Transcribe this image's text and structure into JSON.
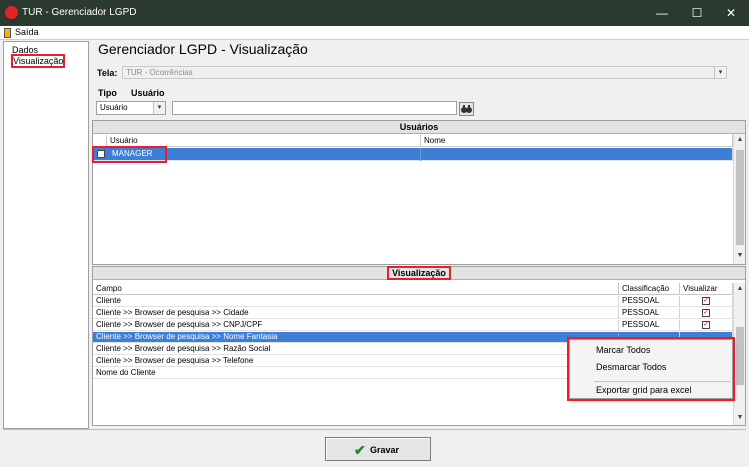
{
  "window": {
    "title": "TUR - Gerenciador LGPD",
    "minimize": "—",
    "maximize": "☐",
    "close": "✕"
  },
  "menubar": {
    "exit_label": "Saída"
  },
  "sidebar": {
    "items": [
      {
        "label": "Dados"
      },
      {
        "label": "Visualização"
      }
    ]
  },
  "main": {
    "heading": "Gerenciador LGPD - Visualização",
    "tela_label": "Tela:",
    "tela_value": "TUR - Ocorrências",
    "tipo_label": "Tipo",
    "usuario_label": "Usuário",
    "tipo_value": "Usuário",
    "usuario_value": ""
  },
  "usuarios_grid": {
    "title": "Usuários",
    "columns": [
      "Usuário",
      "Nome"
    ],
    "rows": [
      {
        "usuario": "MANAGER",
        "nome": ""
      }
    ]
  },
  "visualizacao_grid": {
    "title": "Visualização",
    "columns": [
      "Campo",
      "Classificação",
      "Visualizar"
    ],
    "rows": [
      {
        "campo": "Cliente",
        "classificacao": "PESSOAL",
        "visualizar": "✓"
      },
      {
        "campo": "Cliente >> Browser de pesquisa >> Cidade",
        "classificacao": "PESSOAL",
        "visualizar": "✓"
      },
      {
        "campo": "Cliente >> Browser de pesquisa >> CNPJ/CPF",
        "classificacao": "PESSOAL",
        "visualizar": "✓"
      },
      {
        "campo": "Cliente >> Browser de pesquisa >> Nome Fantasia",
        "classificacao": "",
        "visualizar": ""
      },
      {
        "campo": "Cliente >> Browser de pesquisa >> Razão Social",
        "classificacao": "",
        "visualizar": ""
      },
      {
        "campo": "Cliente >> Browser de pesquisa >> Telefone",
        "classificacao": "",
        "visualizar": ""
      },
      {
        "campo": "Nome do Cliente",
        "classificacao": "",
        "visualizar": ""
      }
    ]
  },
  "context_menu": {
    "items": [
      "Marcar Todos",
      "Desmarcar Todos",
      "Exportar grid para excel"
    ]
  },
  "footer": {
    "save_label": "Gravar"
  },
  "colors": {
    "accent_red": "#e8202a",
    "selection_blue": "#3d7fd6",
    "titlebar": "#2b3a2f"
  }
}
